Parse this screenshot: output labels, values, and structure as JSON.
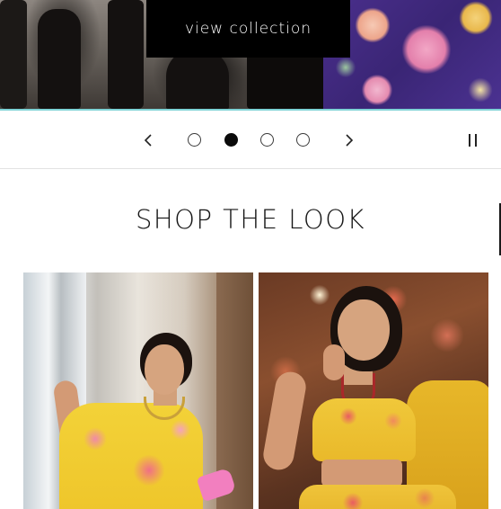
{
  "hero": {
    "cta_label": "view collection"
  },
  "carousel": {
    "prev_label": "Previous slide",
    "next_label": "Next slide",
    "pause_label": "Pause slideshow",
    "slide_count": 4,
    "active_slide": 2
  },
  "section": {
    "title": "SHOP THE LOOK"
  },
  "colors": {
    "cta_background": "#000000",
    "cta_text": "#ffffff",
    "hero_underline": "#7fd3d6",
    "active_dot": "#0a0a0a",
    "divider": "#e2e2e2"
  },
  "icons": {
    "prev": "chevron-left-icon",
    "next": "chevron-right-icon",
    "pause": "pause-icon"
  },
  "products": [
    {
      "image": "model-in-yellow-floral-dress-with-pink-clutch"
    },
    {
      "image": "model-in-yellow-floral-lehenga-with-dupatta"
    }
  ]
}
